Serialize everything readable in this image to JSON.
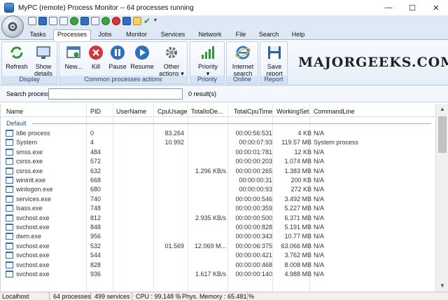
{
  "window": {
    "title": "MyPC (remote) Process Monitor -- 64 processes running",
    "minimize": "—",
    "maximize": "☐",
    "close": "✕"
  },
  "tabs": [
    "Tasks",
    "Processes",
    "Jobs",
    "Monitor",
    "Services",
    "Network",
    "File",
    "Search",
    "Help"
  ],
  "ribbon": {
    "display": {
      "caption": "Display",
      "refresh": "Refresh",
      "show_details_1": "Show",
      "show_details_2": "details"
    },
    "actions": {
      "caption": "Common processes actions",
      "new": "New...",
      "kill": "Kill",
      "pause": "Pause",
      "resume": "Resume",
      "other_1": "Other",
      "other_2": "actions"
    },
    "priority": {
      "caption": "Priority",
      "label": "Priority"
    },
    "online": {
      "caption": "Online",
      "label_1": "Internet",
      "label_2": "search"
    },
    "report": {
      "caption": "Report",
      "label_1": "Save",
      "label_2": "report"
    }
  },
  "watermark": "MAJORGEEKS.COM",
  "search": {
    "label": "Search process",
    "value": "",
    "result": "0 result(s)"
  },
  "columns": [
    "Name",
    "PID",
    "UserName",
    "CpuUsage",
    "TotalIoDe...",
    "TotalCpuTime",
    "WorkingSet",
    "CommandLine"
  ],
  "group": "Default",
  "rows": [
    [
      "Idle process",
      "0",
      "",
      "83.264",
      "",
      "00:00:56:531",
      "4 KB",
      "N/A"
    ],
    [
      "System",
      "4",
      "",
      "10.992",
      "",
      "00:00:07:93",
      "119.57 MB",
      "System process"
    ],
    [
      "smss.exe",
      "484",
      "",
      "",
      "",
      "00:00:01:781",
      "12 KB",
      "N/A"
    ],
    [
      "csrss.exe",
      "572",
      "",
      "",
      "",
      "00:00:00:203",
      "1.074 MB",
      "N/A"
    ],
    [
      "csrss.exe",
      "632",
      "",
      "",
      "1.296 KB/s",
      "00:00:00:265",
      "1.383 MB",
      "N/A"
    ],
    [
      "wininit.exe",
      "668",
      "",
      "",
      "",
      "00:00:00:31",
      "200 KB",
      "N/A"
    ],
    [
      "winlogon.exe",
      "680",
      "",
      "",
      "",
      "00:00:00:93",
      "272 KB",
      "N/A"
    ],
    [
      "services.exe",
      "740",
      "",
      "",
      "",
      "00:00:00:546",
      "3.492 MB",
      "N/A"
    ],
    [
      "lsass.exe",
      "748",
      "",
      "",
      "",
      "00:00:00:359",
      "5.227 MB",
      "N/A"
    ],
    [
      "svchost.exe",
      "812",
      "",
      "",
      "2.935 KB/s",
      "00:00:00:500",
      "6.371 MB",
      "N/A"
    ],
    [
      "svchost.exe",
      "848",
      "",
      "",
      "",
      "00:00:00:828",
      "5.191 MB",
      "N/A"
    ],
    [
      "dwm.exe",
      "956",
      "",
      "",
      "",
      "00:00:00:343",
      "10.77 MB",
      "N/A"
    ],
    [
      "svchost.exe",
      "532",
      "",
      "01.569",
      "12.069 M...",
      "00:00:06:375",
      "63.066 MB",
      "N/A"
    ],
    [
      "svchost.exe",
      "544",
      "",
      "",
      "",
      "00:00:00:421",
      "3.762 MB",
      "N/A"
    ],
    [
      "svchost.exe",
      "828",
      "",
      "",
      "",
      "00:00:00:468",
      "8.008 MB",
      "N/A"
    ],
    [
      "svchost.exe",
      "936",
      "",
      "",
      "1.617 KB/s",
      "00:00:00:140",
      "4.988 MB",
      "N/A"
    ]
  ],
  "status": {
    "host": "Localhost",
    "processes": "64 processes",
    "services": "499 services",
    "cpu": "CPU : 99.148 %",
    "memory": "Phys. Memory : 65.481 %"
  }
}
